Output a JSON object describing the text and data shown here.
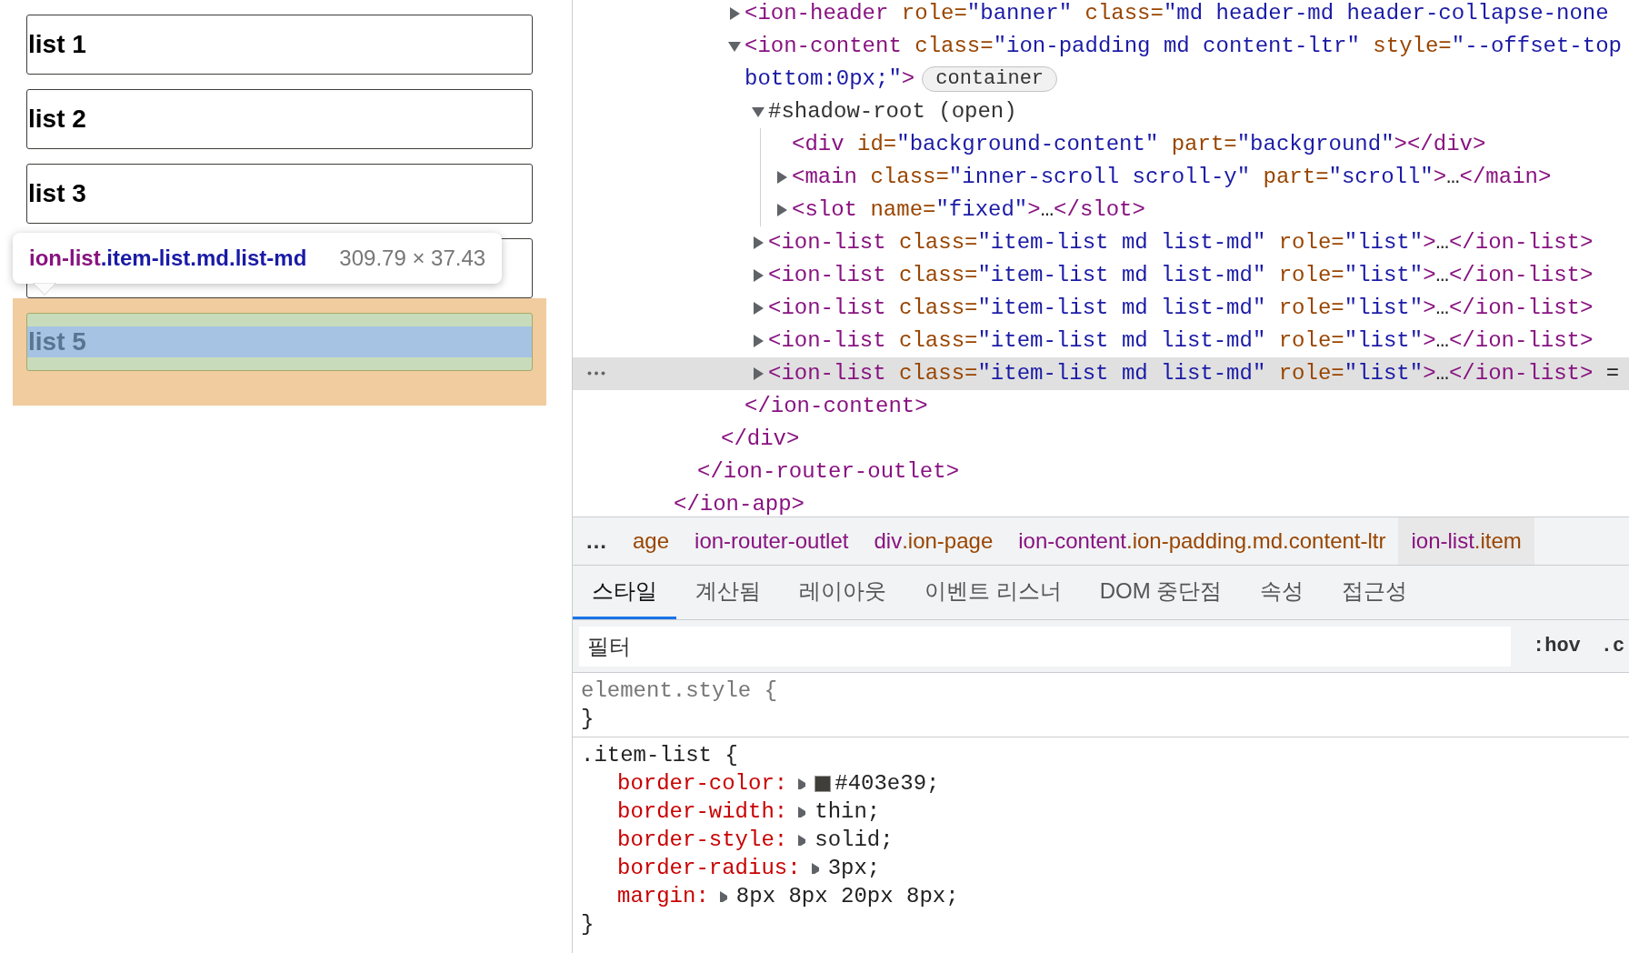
{
  "preview": {
    "items": [
      {
        "label": "list 1",
        "highlighted": false
      },
      {
        "label": "list 2",
        "highlighted": false
      },
      {
        "label": "list 3",
        "highlighted": false
      },
      {
        "highlighted": false
      },
      {
        "label": "list 5",
        "highlighted": true
      }
    ],
    "tooltip": {
      "tag": "ion-list",
      "classes": ".item-list.md.list-md",
      "size": "309.79 × 37.43"
    }
  },
  "dom_tree": [
    {
      "close": "</ion-app>",
      "children": [
        {
          "close": "</ion-router-outlet>",
          "children": [
            {
              "close": "</div>",
              "children": [
                {
                  "open": "<ion-header role=\"banner\" class=\"md header-md header-collapse-none",
                  "expanded": false,
                  "selected": false
                },
                {
                  "open": "<ion-content class=\"ion-padding md content-ltr\" style=\"--offset-top",
                  "open_continued": "bottom:0px;\">",
                  "badge": "container",
                  "expanded": true,
                  "selected": false,
                  "close": "</ion-content>",
                  "children": [
                    {
                      "kind": "shadow-root",
                      "open": "#shadow-root (open)",
                      "expanded": true,
                      "selected": false,
                      "children": [
                        {
                          "open": "<div id=\"background-content\" part=\"background\"></div>",
                          "selected": false
                        },
                        {
                          "open": "<main class=\"inner-scroll scroll-y\" part=\"scroll\">…</main>",
                          "expanded": false,
                          "selected": false
                        },
                        {
                          "open": "<slot name=\"fixed\">…</slot>",
                          "expanded": false,
                          "selected": false
                        }
                      ]
                    },
                    {
                      "open": "<ion-list class=\"item-list md list-md\" role=\"list\">…</ion-list>",
                      "expanded": false,
                      "selected": false
                    },
                    {
                      "open": "<ion-list class=\"item-list md list-md\" role=\"list\">…</ion-list>",
                      "expanded": false,
                      "selected": false
                    },
                    {
                      "open": "<ion-list class=\"item-list md list-md\" role=\"list\">…</ion-list>",
                      "expanded": false,
                      "selected": false
                    },
                    {
                      "open": "<ion-list class=\"item-list md list-md\" role=\"list\">…</ion-list>",
                      "expanded": false,
                      "selected": false
                    },
                    {
                      "open": "<ion-list class=\"item-list md list-md\" role=\"list\">…</ion-list>",
                      "expanded": false,
                      "selected": true,
                      "suffix": "="
                    }
                  ]
                }
              ]
            }
          ]
        }
      ]
    }
  ],
  "breadcrumbs": {
    "overflow": "…",
    "items": [
      {
        "classes": "age",
        "selected": false
      },
      {
        "tag": "ion-router-outlet",
        "selected": false
      },
      {
        "tag": "div",
        "classes": ".ion-page",
        "selected": false
      },
      {
        "tag": "ion-content",
        "classes": ".ion-padding.md.content-ltr",
        "selected": false
      },
      {
        "tag": "ion-list",
        "classes": ".item",
        "selected": true
      }
    ]
  },
  "tabs": [
    {
      "label": "스타일",
      "selected": true
    },
    {
      "label": "계산됨",
      "selected": false
    },
    {
      "label": "레이아웃",
      "selected": false
    },
    {
      "label": "이벤트 리스너",
      "selected": false
    },
    {
      "label": "DOM 중단점",
      "selected": false
    },
    {
      "label": "속성",
      "selected": false
    },
    {
      "label": "접근성",
      "selected": false
    }
  ],
  "filter": {
    "placeholder": "필터",
    "toggles": [
      ":hov",
      ".c"
    ]
  },
  "rules": [
    {
      "kind": "inline",
      "selector": "element.style {",
      "close": "}"
    },
    {
      "kind": "rule",
      "selector": ".item-list {",
      "close": "}",
      "declarations": [
        {
          "property": "border-color:",
          "value": "#403e39;",
          "color": "#403e39"
        },
        {
          "property": "border-width:",
          "value": "thin;"
        },
        {
          "property": "border-style:",
          "value": "solid;"
        },
        {
          "property": "border-radius:",
          "value": "3px;"
        },
        {
          "property": "margin:",
          "value": "8px 8px 20px 8px;"
        }
      ]
    }
  ]
}
